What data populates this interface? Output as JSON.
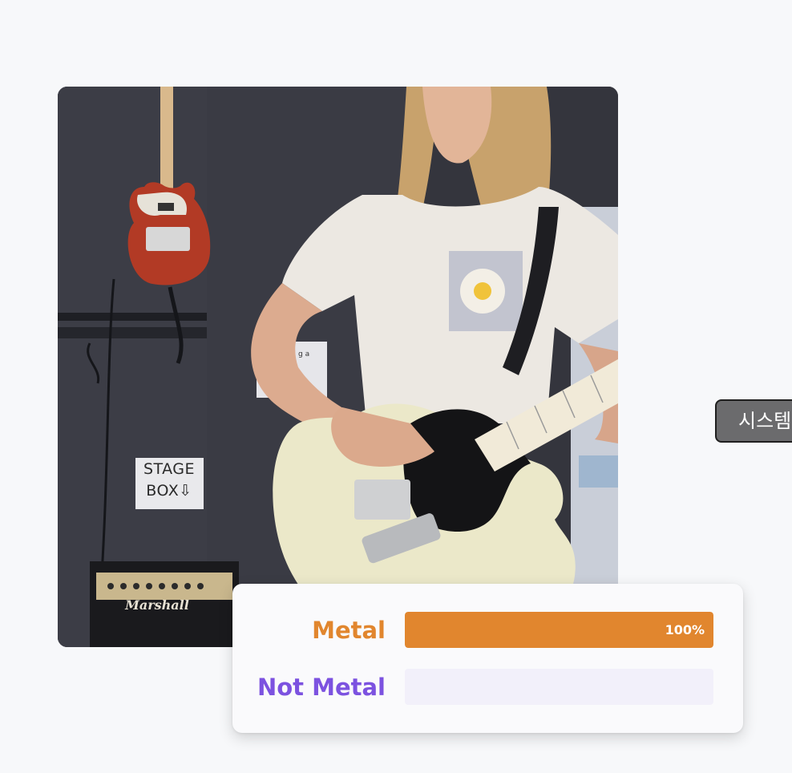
{
  "video": {
    "stage_sign_line1": "STAGE",
    "stage_sign_line2": "BOX⇩",
    "amp_brand": "Marshall",
    "wall_note": "g a"
  },
  "classifier": {
    "results": [
      {
        "label": "Metal",
        "percent_text": "100%",
        "score": 1.0,
        "color": "#e1862e"
      },
      {
        "label": "Not Metal",
        "percent_text": "",
        "score": 0.0,
        "color": "#7c52e0"
      }
    ]
  },
  "system_button": {
    "label": "시스템"
  }
}
